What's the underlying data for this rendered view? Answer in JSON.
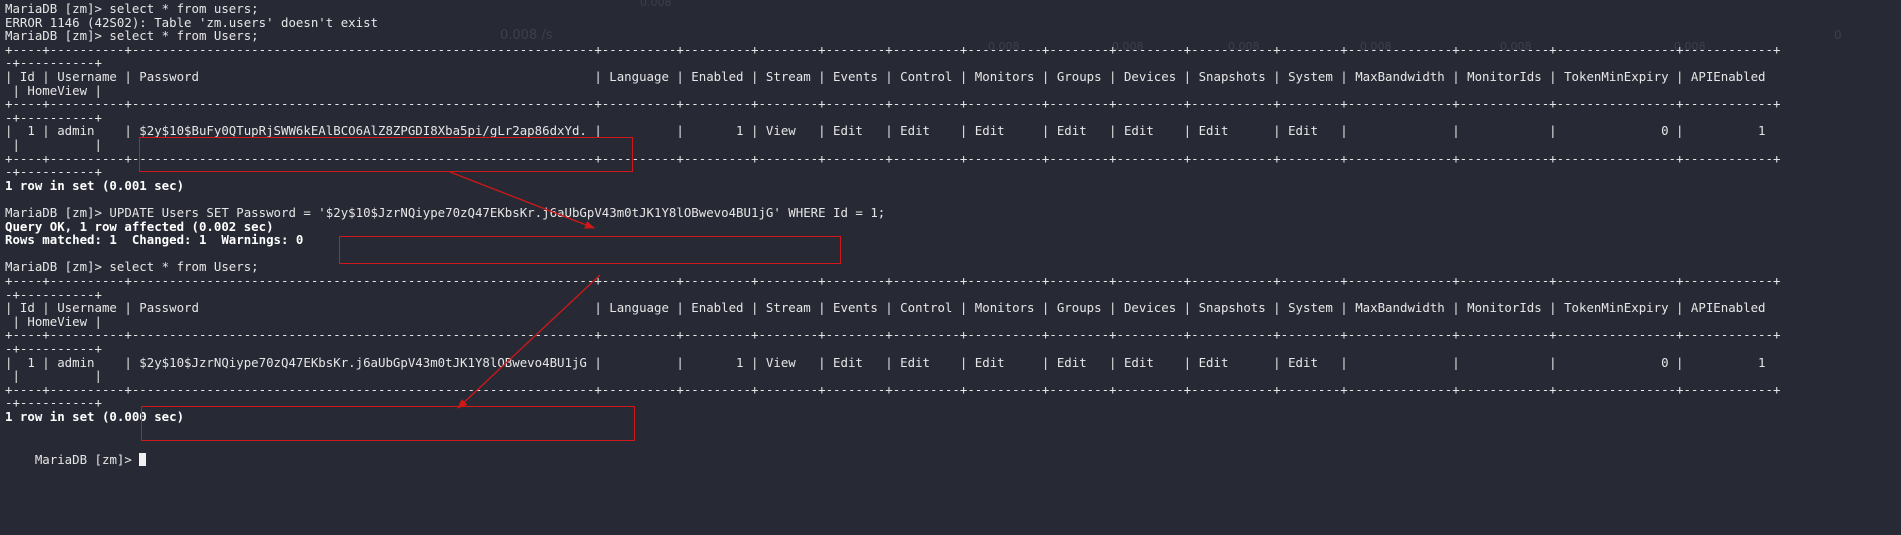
{
  "terminal": {
    "background_color": "#272a35",
    "text_color": "#e6e6e6",
    "highlight_color": "#d01818",
    "prompt": "MariaDB [zm]> ",
    "lines": [
      "MariaDB [zm]> select * from users;",
      "ERROR 1146 (42S02): Table 'zm.users' doesn't exist",
      "MariaDB [zm]> select * from Users;",
      "+----+----------+--------------------------------------------------------------+----------+---------+--------+--------+---------+----------+--------+---------+-----------+--------+--------------+------------+----------------+------------+",
      "-+----------+",
      "| Id | Username | Password                                                     | Language | Enabled | Stream | Events | Control | Monitors | Groups | Devices | Snapshots | System | MaxBandwidth | MonitorIds | TokenMinExpiry | APIEnabled",
      " | HomeView |",
      "+----+----------+--------------------------------------------------------------+----------+---------+--------+--------+---------+----------+--------+---------+-----------+--------+--------------+------------+----------------+------------+",
      "-+----------+",
      "|  1 | admin    | $2y$10$BuFy0QTupRjSWW6kEAlBCO6AlZ8ZPGDI8Xba5pi/gLr2ap86dxYd. |          |       1 | View   | Edit   | Edit    | Edit     | Edit   | Edit    | Edit      | Edit   |              |            |              0 |          1",
      " |          |",
      "+----+----------+--------------------------------------------------------------+----------+---------+--------+--------+---------+----------+--------+---------+-----------+--------+--------------+------------+----------------+------------+",
      "-+----------+",
      "1 row in set (0.001 sec)",
      "",
      "MariaDB [zm]> UPDATE Users SET Password = '$2y$10$JzrNQiype70zQ47EKbsKr.j6aUbGpV43m0tJK1Y8lOBwevo4BU1jG' WHERE Id = 1;",
      "Query OK, 1 row affected (0.002 sec)",
      "Rows matched: 1  Changed: 1  Warnings: 0",
      "",
      "MariaDB [zm]> select * from Users;",
      "+----+----------+--------------------------------------------------------------+----------+---------+--------+--------+---------+----------+--------+---------+-----------+--------+--------------+------------+----------------+------------+",
      "-+----------+",
      "| Id | Username | Password                                                     | Language | Enabled | Stream | Events | Control | Monitors | Groups | Devices | Snapshots | System | MaxBandwidth | MonitorIds | TokenMinExpiry | APIEnabled",
      " | HomeView |",
      "+----+----------+--------------------------------------------------------------+----------+---------+--------+--------+---------+----------+--------+---------+-----------+--------+--------------+------------+----------------+------------+",
      "-+----------+",
      "|  1 | admin    | $2y$10$JzrNQiype70zQ47EKbsKr.j6aUbGpV43m0tJK1Y8lOBwevo4BU1jG |          |       1 | View   | Edit   | Edit    | Edit     | Edit   | Edit    | Edit      | Edit   |              |            |              0 |          1",
      " |          |",
      "+----+----------+--------------------------------------------------------------+----------+---------+--------+--------+---------+----------+--------+---------+-----------+--------+--------------+------------+----------------+------------+",
      "-+----------+",
      "1 row in set (0.000 sec)",
      "",
      "MariaDB [zm]> "
    ],
    "bold_line_indices": [
      13,
      16,
      17,
      30
    ]
  },
  "background_ghost": {
    "rate_label": "0.008 /s",
    "small_labels": [
      "0.008",
      "0.008",
      "0.008",
      "0.008",
      "0.008",
      "0.008",
      "0.008"
    ],
    "corner_zero": "0"
  }
}
